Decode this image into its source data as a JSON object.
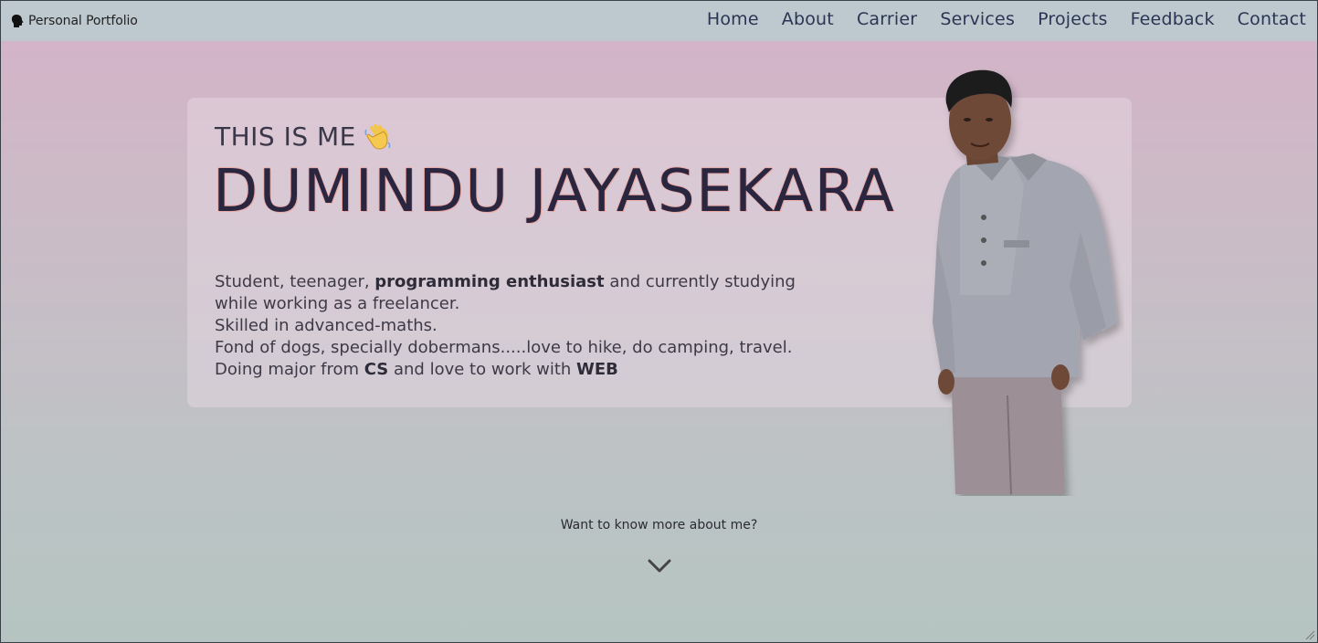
{
  "navbar": {
    "brand_icon": "head-silhouette-icon",
    "brand_label": "Personal Portfolio",
    "links": [
      {
        "label": "Home"
      },
      {
        "label": "About"
      },
      {
        "label": "Carrier"
      },
      {
        "label": "Services"
      },
      {
        "label": "Projects"
      },
      {
        "label": "Feedback"
      },
      {
        "label": "Contact"
      }
    ]
  },
  "hero": {
    "greeting": "THIS IS ME",
    "greeting_icon": "waving-hand-icon",
    "name": "DUMINDU JAYASEKARA",
    "bio": {
      "line1_pre": "Student, teenager, ",
      "line1_bold": "programming enthusiast",
      "line1_post": " and currently studying while working as a freelancer.",
      "line2": "Skilled in advanced-maths.",
      "line3": "Fond of dogs, specially dobermans.....love to hike, do camping, travel.",
      "line4_pre": "Doing major from ",
      "line4_bold1": "CS",
      "line4_mid": " and love to work with ",
      "line4_bold2": "WEB"
    }
  },
  "more": {
    "text": "Want to know more about me?",
    "icon": "chevron-down-icon"
  },
  "colors": {
    "nav_bg": "#bdc9cf",
    "nav_text": "#2b3553",
    "name_text": "#2a2640",
    "name_glow": "#e8a9a6"
  }
}
